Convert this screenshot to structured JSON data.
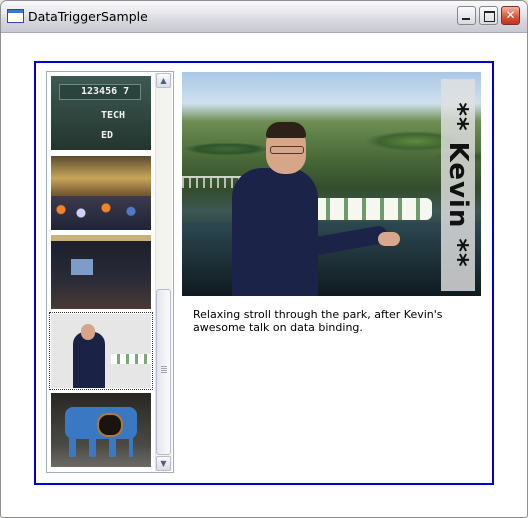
{
  "window": {
    "title": "DataTriggerSample",
    "minimize_glyph": "",
    "close_glyph": "✕"
  },
  "thumbnails": [
    {
      "name": "scoreboard",
      "text_lines": [
        "123456 7",
        "TECH",
        "ED"
      ],
      "selected": false
    },
    {
      "name": "audience-room",
      "selected": false
    },
    {
      "name": "presentation-hall",
      "selected": false
    },
    {
      "name": "park-stroll",
      "selected": true
    },
    {
      "name": "painted-cow",
      "selected": false
    }
  ],
  "scrollbar": {
    "up_arrow": "▲",
    "down_arrow": "▼"
  },
  "detail": {
    "name_label": "** Kevin **",
    "caption": "Relaxing stroll through the park, after Kevin's awesome talk on data binding."
  },
  "colors": {
    "frame_border": "#0000d6",
    "window_bg": "#ffffff"
  }
}
